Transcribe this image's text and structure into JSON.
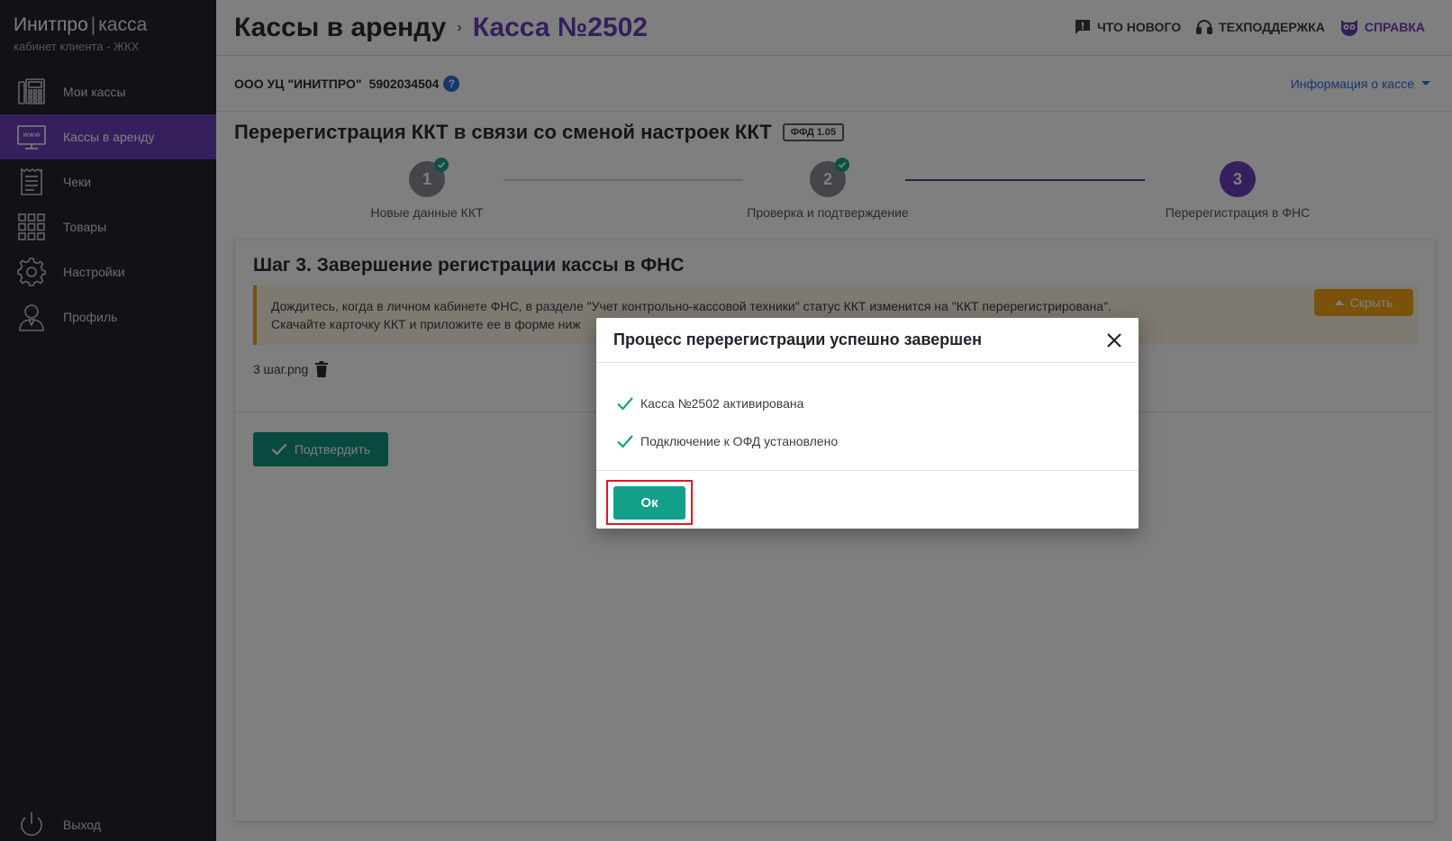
{
  "brand": {
    "name": "Инитпро",
    "separator": "|",
    "product": "касса",
    "subtitle": "кабинет клиента - ЖКХ"
  },
  "sidebar": {
    "items": [
      {
        "label": "Мои кассы",
        "icon": "cash-register-icon"
      },
      {
        "label": "Кассы в аренду",
        "icon": "www-monitor-icon",
        "active": true
      },
      {
        "label": "Чеки",
        "icon": "receipt-icon"
      },
      {
        "label": "Товары",
        "icon": "grid-icon"
      },
      {
        "label": "Настройки",
        "icon": "gear-icon"
      },
      {
        "label": "Профиль",
        "icon": "user-icon"
      }
    ],
    "logout": {
      "label": "Выход",
      "icon": "power-icon"
    }
  },
  "header": {
    "breadcrumb_1": "Кассы в аренду",
    "breadcrumb_arrow": "›",
    "breadcrumb_2": "Касса №2502",
    "links": {
      "whats_new": "ЧТО НОВОГО",
      "support": "ТЕХПОДДЕРЖКА",
      "help": "СПРАВКА"
    }
  },
  "org": {
    "name": "ООО УЦ \"ИНИТПРО\"",
    "inn": "5902034504",
    "help": "?",
    "info_link": "Информация о кассе"
  },
  "section": {
    "title": "Перерегистрация ККТ в связи со сменой настроек ККТ",
    "badge": "ФФД 1.05"
  },
  "stepper": [
    {
      "number": "1",
      "label": "Новые данные ККТ",
      "state": "done"
    },
    {
      "number": "2",
      "label": "Проверка и подтверждение",
      "state": "done"
    },
    {
      "number": "3",
      "label": "Перерегистрация в ФНС",
      "state": "current"
    }
  ],
  "card": {
    "title": "Шаг 3. Завершение регистрации кассы в ФНС",
    "alert_line1": "Дождитесь, когда в личном кабинете ФНС, в разделе \"Учет контрольно-кассовой техники\" статус ККТ изменится на \"ККТ перерегистрирована\".",
    "alert_line2": "Скачайте карточку ККТ и приложите ее в форме ниж",
    "hide_label": "Скрыть",
    "file_name": "3 шаг.png",
    "confirm_label": "Подтвердить"
  },
  "modal": {
    "title": "Процесс перерегистрации успешно завершен",
    "items": [
      "Касса №2502 активирована",
      "Подключение к ОФД установлено"
    ],
    "ok_label": "Ок"
  },
  "colors": {
    "sidebar_bg": "#23232e",
    "accent_purple": "#6b3fb8",
    "success_green": "#12a08a",
    "warning_orange": "#f5a418",
    "highlight_red": "#e8141e"
  }
}
